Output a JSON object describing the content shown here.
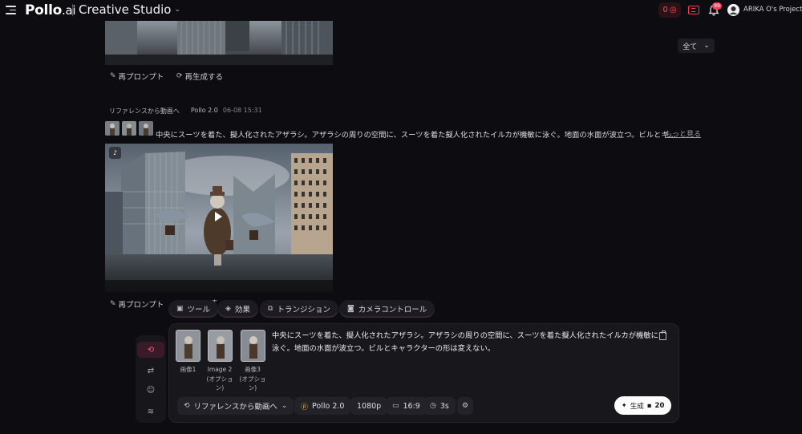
{
  "topbar": {
    "logo": "Pollo",
    "logo_suffix": ".ai",
    "app_title": "Creative Studio",
    "credits": "0",
    "notification_count": "99",
    "user_name": "ARIKA O's Project"
  },
  "filter": {
    "label": "全て"
  },
  "feed": {
    "top_actions": {
      "reprompt": "再プロンプト",
      "regenerate": "再生成する"
    },
    "item": {
      "tag": "リファレンスから動画へ",
      "model": "Pollo 2.0",
      "date": "06-08 15:31",
      "prompt": "中央にスーツを着た、擬人化されたアザラシ。アザラシの周りの空間に、スーツを着た擬人化されたイルカが機敏に泳ぐ。地面の水面が波立つ。ビルとキ...",
      "more": "もっと見る",
      "bottom_action": "再プロンプト",
      "bottom_action_tail": "す"
    }
  },
  "toolbar": {
    "chips": [
      "ツール",
      "効果",
      "トランジション",
      "カメラコントロール"
    ]
  },
  "composer": {
    "refs": [
      {
        "label": "画像1"
      },
      {
        "label": "Image 2\n(オプション)"
      },
      {
        "label": "画像3\n(オプション)"
      }
    ],
    "prompt": "中央にスーツを着た、擬人化されたアザラシ。アザラシの周りの空間に、スーツを着た擬人化されたイルカが機敏に泳ぐ。地面の水面が波立つ。ビルとキャラクターの形は変えない。",
    "mode": "リファレンスから動画へ",
    "model": "Pollo 2.0",
    "resolution": "1080p",
    "aspect": "16:9",
    "duration": "3s",
    "generate_label": "生成",
    "generate_cost": "20"
  },
  "colors": {
    "accent": "#ff3b5c",
    "background": "#0d0c10",
    "panel": "#18171c"
  }
}
